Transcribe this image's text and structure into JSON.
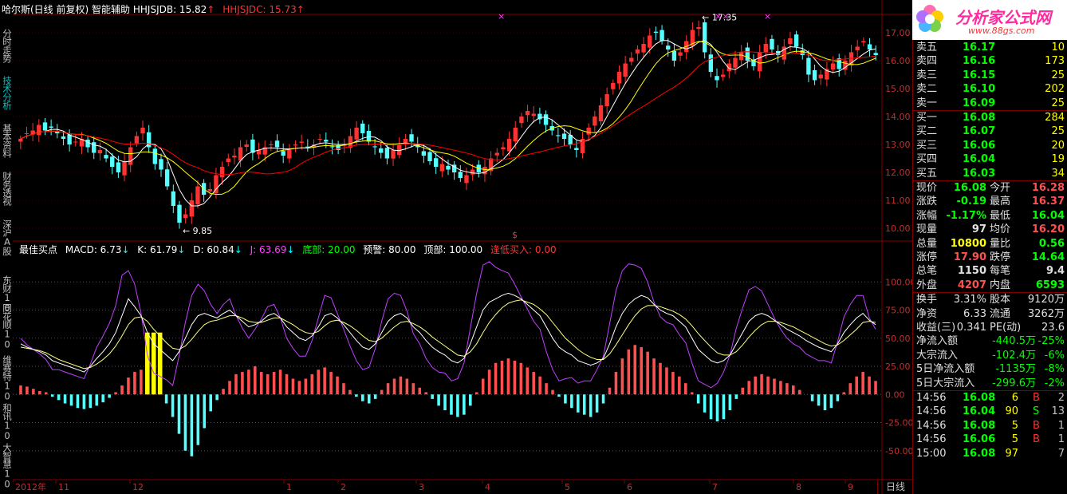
{
  "header": {
    "stock": "哈尔斯(日线 前复权)",
    "indicator_name": "智能辅助",
    "hhjsjdb": "HHJSJDB: 15.82",
    "hhjsjdc": "HHJSJDC: 15.73",
    "up_arrow": "↑"
  },
  "sub_header": {
    "name": "最佳买点",
    "macd": "MACD: 6.73",
    "k": "K: 61.79",
    "d": "D: 60.84",
    "j": "J: 63.69",
    "bottom": "底部: 20.00",
    "warn": "预警: 80.00",
    "top": "顶部: 100.00",
    "buy": "逢低买入: 0.00",
    "down_arrow": "↓"
  },
  "side_tabs": [
    {
      "label": "分时走势",
      "active": false
    },
    {
      "label": "技术分析",
      "active": true
    },
    {
      "label": "基本资料",
      "active": false
    },
    {
      "label": "财务透视",
      "active": false
    },
    {
      "label": "深沪A股",
      "active": false
    },
    {
      "label": "东财10",
      "active": false
    },
    {
      "label": "同花顺10",
      "active": false
    },
    {
      "label": "维赛特10",
      "active": false
    },
    {
      "label": "和讯10",
      "active": false
    },
    {
      "label": "大智慧10",
      "active": false
    }
  ],
  "chart_data": [
    {
      "type": "candlestick",
      "y_ticks": [
        "17.00",
        "16.00",
        "15.00",
        "14.00",
        "13.00",
        "12.00",
        "11.00",
        "10.00"
      ],
      "ylim": [
        9.6,
        17.6
      ],
      "annotations": {
        "high": "17.35",
        "low": "9.85"
      },
      "ma_colors": {
        "ma1": "#ffffff",
        "ma2": "#ffff00",
        "ma3": "#ff0000"
      },
      "up_color": "#ff3232",
      "down_color": "#54ffff",
      "closes": [
        13.2,
        13.4,
        13.5,
        13.7,
        13.5,
        13.6,
        13.4,
        13.2,
        13.0,
        13.1,
        13.2,
        12.9,
        12.7,
        12.8,
        12.5,
        12.2,
        12.0,
        12.4,
        12.9,
        13.3,
        13.6,
        12.9,
        12.3,
        12.1,
        11.5,
        10.8,
        10.2,
        10.5,
        11.0,
        11.5,
        11.2,
        11.4,
        11.9,
        12.2,
        12.5,
        12.6,
        12.9,
        13.0,
        12.7,
        12.8,
        12.9,
        13.0,
        12.9,
        12.6,
        12.8,
        13.0,
        13.1,
        12.9,
        13.0,
        13.2,
        13.1,
        12.9,
        12.8,
        13.0,
        13.3,
        13.6,
        13.4,
        13.1,
        12.9,
        12.7,
        12.5,
        12.8,
        13.0,
        13.2,
        13.1,
        12.9,
        12.6,
        12.4,
        12.2,
        12.3,
        12.1,
        12.0,
        11.8,
        11.9,
        12.1,
        12.0,
        12.2,
        12.5,
        12.7,
        12.9,
        13.2,
        13.6,
        14.0,
        14.2,
        14.1,
        13.9,
        13.7,
        13.5,
        13.3,
        13.2,
        13.0,
        12.8,
        13.2,
        13.6,
        14.0,
        14.4,
        14.8,
        15.2,
        15.6,
        15.9,
        16.1,
        16.4,
        16.6,
        16.9,
        17.0,
        16.7,
        16.4,
        16.0,
        16.3,
        16.7,
        17.1,
        17.2,
        16.3,
        15.6,
        15.3,
        15.5,
        15.9,
        16.1,
        16.3,
        16.0,
        15.8,
        16.3,
        16.6,
        16.4,
        16.2,
        16.5,
        16.8,
        16.5,
        16.2,
        15.5,
        15.3,
        15.5,
        15.7,
        15.9,
        15.7,
        16.0,
        16.3,
        16.5,
        16.7,
        16.4,
        16.2
      ]
    },
    {
      "type": "indicator",
      "y_ticks": [
        "100.00",
        "75.00",
        "50.00",
        "25.00",
        "0.00",
        "-25.00",
        "-50.00"
      ],
      "ylim": [
        -75,
        125
      ],
      "x_ticks": [
        "2012年",
        "11",
        "12",
        "1",
        "2",
        "3",
        "4",
        "5",
        "6",
        "7",
        "8",
        "9"
      ],
      "k": [
        45,
        42,
        40,
        38,
        35,
        30,
        28,
        26,
        24,
        22,
        20,
        25,
        32,
        38,
        45,
        55,
        70,
        85,
        78,
        70,
        55,
        45,
        40,
        35,
        30,
        38,
        50,
        62,
        70,
        72,
        70,
        68,
        72,
        75,
        70,
        65,
        60,
        62,
        65,
        70,
        72,
        68,
        60,
        55,
        50,
        48,
        52,
        60,
        70,
        72,
        68,
        62,
        55,
        48,
        42,
        40,
        45,
        55,
        65,
        70,
        72,
        68,
        60,
        55,
        48,
        42,
        38,
        35,
        30,
        28,
        32,
        45,
        60,
        75,
        82,
        85,
        88,
        90,
        88,
        85,
        80,
        75,
        70,
        60,
        50,
        42,
        38,
        35,
        30,
        28,
        26,
        28,
        32,
        45,
        60,
        72,
        80,
        85,
        88,
        86,
        80,
        75,
        72,
        70,
        65,
        60,
        50,
        40,
        35,
        30,
        28,
        30,
        35,
        45,
        55,
        65,
        70,
        72,
        70,
        66,
        62,
        58,
        55,
        52,
        48,
        45,
        42,
        40,
        38,
        45,
        55,
        62,
        68,
        72,
        66,
        62
      ],
      "d": [
        42,
        41,
        40,
        39,
        37,
        34,
        31,
        29,
        27,
        25,
        23,
        24,
        27,
        31,
        36,
        43,
        52,
        62,
        68,
        69,
        65,
        58,
        52,
        46,
        41,
        40,
        43,
        49,
        56,
        62,
        65,
        66,
        68,
        70,
        70,
        68,
        65,
        64,
        64,
        66,
        68,
        68,
        65,
        62,
        58,
        55,
        54,
        56,
        61,
        65,
        66,
        64,
        61,
        57,
        52,
        48,
        47,
        50,
        55,
        60,
        64,
        65,
        63,
        60,
        56,
        51,
        47,
        43,
        39,
        35,
        34,
        38,
        45,
        55,
        64,
        71,
        77,
        81,
        83,
        84,
        82,
        80,
        76,
        71,
        64,
        57,
        50,
        45,
        40,
        36,
        33,
        31,
        31,
        36,
        44,
        53,
        62,
        70,
        76,
        79,
        79,
        78,
        76,
        74,
        71,
        67,
        61,
        54,
        48,
        42,
        37,
        35,
        35,
        38,
        44,
        51,
        57,
        62,
        65,
        65,
        64,
        62,
        60,
        57,
        54,
        51,
        48,
        45,
        43,
        44,
        48,
        53,
        58,
        64,
        65,
        64
      ],
      "j": [
        50,
        44,
        40,
        36,
        31,
        22,
        22,
        20,
        18,
        16,
        14,
        27,
        42,
        52,
        63,
        79,
        106,
        110,
        98,
        72,
        35,
        19,
        16,
        13,
        8,
        34,
        64,
        88,
        98,
        92,
        80,
        72,
        80,
        85,
        70,
        59,
        50,
        58,
        67,
        78,
        80,
        68,
        50,
        41,
        34,
        34,
        48,
        68,
        88,
        86,
        72,
        58,
        43,
        30,
        22,
        24,
        41,
        65,
        85,
        90,
        88,
        74,
        54,
        45,
        32,
        24,
        20,
        19,
        12,
        14,
        28,
        59,
        90,
        115,
        118,
        113,
        110,
        108,
        98,
        87,
        76,
        65,
        58,
        38,
        22,
        12,
        14,
        15,
        10,
        12,
        12,
        22,
        34,
        63,
        92,
        110,
        116,
        115,
        112,
        100,
        82,
        69,
        64,
        62,
        53,
        46,
        28,
        12,
        9,
        6,
        10,
        20,
        35,
        59,
        77,
        93,
        96,
        92,
        80,
        68,
        58,
        50,
        45,
        42,
        36,
        33,
        30,
        30,
        28,
        47,
        69,
        80,
        88,
        88,
        68,
        58
      ],
      "macd": [
        8,
        7,
        5,
        3,
        2,
        -2,
        -5,
        -8,
        -10,
        -12,
        -13,
        -12,
        -10,
        -7,
        -3,
        2,
        8,
        15,
        20,
        22,
        18,
        10,
        2,
        -8,
        -20,
        -35,
        -50,
        -55,
        -45,
        -30,
        -15,
        -5,
        5,
        12,
        18,
        20,
        22,
        25,
        20,
        18,
        20,
        22,
        18,
        14,
        12,
        14,
        18,
        22,
        24,
        20,
        16,
        10,
        4,
        -2,
        -6,
        -8,
        -4,
        4,
        10,
        14,
        16,
        14,
        10,
        6,
        2,
        -4,
        -10,
        -14,
        -18,
        -20,
        -18,
        -10,
        2,
        14,
        22,
        28,
        30,
        32,
        30,
        28,
        24,
        20,
        16,
        10,
        4,
        -2,
        -8,
        -12,
        -16,
        -18,
        -20,
        -16,
        -8,
        6,
        20,
        32,
        40,
        44,
        42,
        38,
        32,
        28,
        24,
        20,
        16,
        10,
        2,
        -8,
        -16,
        -22,
        -24,
        -22,
        -14,
        -4,
        6,
        12,
        16,
        18,
        16,
        14,
        12,
        10,
        8,
        4,
        0,
        -6,
        -10,
        -14,
        -12,
        -6,
        2,
        10,
        16,
        20,
        16,
        12
      ]
    }
  ],
  "top_markers": [
    "×",
    "×",
    "××"
  ],
  "dollar_marker": "$",
  "right_panel": {
    "logo_text": "分析家公式网",
    "logo_url": "www.88gs.com",
    "sells": [
      {
        "label": "卖五",
        "price": "16.17",
        "vol": "10"
      },
      {
        "label": "卖四",
        "price": "16.16",
        "vol": "173"
      },
      {
        "label": "卖三",
        "price": "16.15",
        "vol": "25"
      },
      {
        "label": "卖二",
        "price": "16.10",
        "vol": "202"
      },
      {
        "label": "卖一",
        "price": "16.09",
        "vol": "25"
      }
    ],
    "buys": [
      {
        "label": "买一",
        "price": "16.08",
        "vol": "284"
      },
      {
        "label": "买二",
        "price": "16.07",
        "vol": "25"
      },
      {
        "label": "买三",
        "price": "16.06",
        "vol": "20"
      },
      {
        "label": "买四",
        "price": "16.04",
        "vol": "19"
      },
      {
        "label": "买五",
        "price": "16.03",
        "vol": "34"
      }
    ],
    "quote": [
      {
        "l1": "现价",
        "v1": "16.08",
        "c1": "#00ff00",
        "l2": "今开",
        "v2": "16.28",
        "c2": "#ff5050"
      },
      {
        "l1": "涨跌",
        "v1": "-0.19",
        "c1": "#00ff00",
        "l2": "最高",
        "v2": "16.37",
        "c2": "#ff5050"
      },
      {
        "l1": "涨幅",
        "v1": "-1.17%",
        "c1": "#00ff00",
        "l2": "最低",
        "v2": "16.04",
        "c2": "#00ff00"
      },
      {
        "l1": "现量",
        "v1": "97",
        "c1": "#e0e0e0",
        "l2": "均价",
        "v2": "16.20",
        "c2": "#ff5050"
      },
      {
        "l1": "总量",
        "v1": "10800",
        "c1": "#ffff00",
        "l2": "量比",
        "v2": "0.56",
        "c2": "#00ff00"
      },
      {
        "l1": "涨停",
        "v1": "17.90",
        "c1": "#ff5050",
        "l2": "跌停",
        "v2": "14.64",
        "c2": "#00ff00"
      },
      {
        "l1": "总笔",
        "v1": "1150",
        "c1": "#e0e0e0",
        "l2": "每笔",
        "v2": "9.4",
        "c2": "#e0e0e0"
      },
      {
        "l1": "外盘",
        "v1": "4207",
        "c1": "#ff5050",
        "l2": "内盘",
        "v2": "6593",
        "c2": "#00ff00"
      }
    ],
    "finance": [
      {
        "l1": "换手",
        "v1": "3.31%",
        "l2": "股本",
        "v2": "9120万"
      },
      {
        "l1": "净资",
        "v1": "6.33",
        "l2": "流通",
        "v2": "3262万"
      },
      {
        "l1": "收益(三)",
        "v1": "0.341",
        "l2": "PE(动)",
        "v2": "23.6"
      }
    ],
    "flows": [
      {
        "label": "净流入额",
        "value": "-440.5万",
        "pct": "-25%"
      },
      {
        "label": "大宗流入",
        "value": "-102.4万",
        "pct": "-6%"
      },
      {
        "label": "5日净流入额",
        "value": "-1135万",
        "pct": "-8%"
      },
      {
        "label": "5日大宗流入",
        "value": "-299.6万",
        "pct": "-2%"
      }
    ],
    "ticks": [
      {
        "time": "14:56",
        "price": "16.08",
        "vol": "6",
        "bs": "B",
        "n": "2"
      },
      {
        "time": "14:56",
        "price": "16.04",
        "vol": "90",
        "bs": "S",
        "n": "13"
      },
      {
        "time": "14:56",
        "price": "16.08",
        "vol": "5",
        "bs": "B",
        "n": "1"
      },
      {
        "time": "14:56",
        "price": "16.06",
        "vol": "5",
        "bs": "B",
        "n": "1"
      },
      {
        "time": "15:00",
        "price": "16.08",
        "vol": "97",
        "bs": "",
        "n": "7"
      }
    ]
  },
  "day_button": "日线"
}
